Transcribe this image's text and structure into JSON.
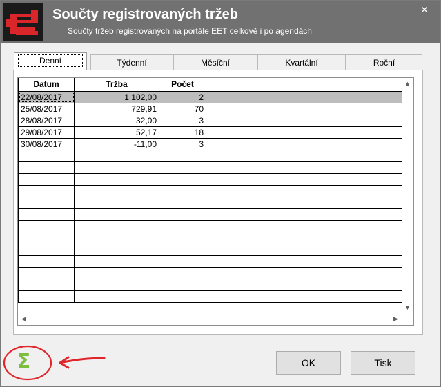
{
  "window": {
    "title": "Součty registrovaných tržeb",
    "subtitle": "Součty tržeb registrovaných na portále EET celkově i po agendách",
    "close_glyph": "✕",
    "accent_color": "#717171"
  },
  "tabs": [
    {
      "label": "Denní",
      "active": true
    },
    {
      "label": "Týdenní",
      "active": false
    },
    {
      "label": "Měsíční",
      "active": false
    },
    {
      "label": "Kvartální",
      "active": false
    },
    {
      "label": "Roční",
      "active": false
    }
  ],
  "table": {
    "columns": [
      "Datum",
      "Tržba",
      "Počet"
    ],
    "rows": [
      {
        "datum": "22/08/2017",
        "trzba": "1 102,00",
        "pocet": "2",
        "selected": true
      },
      {
        "datum": "25/08/2017",
        "trzba": "729,91",
        "pocet": "70",
        "selected": false
      },
      {
        "datum": "28/08/2017",
        "trzba": "32,00",
        "pocet": "3",
        "selected": false
      },
      {
        "datum": "29/08/2017",
        "trzba": "52,17",
        "pocet": "18",
        "selected": false
      },
      {
        "datum": "30/08/2017",
        "trzba": "-11,00",
        "pocet": "3",
        "selected": false
      }
    ]
  },
  "icons": {
    "app": "eet-logo-icon",
    "sum": "sigma-icon",
    "sum_glyph": "Σ",
    "sum_color": "#7cbf3f",
    "annotation_color": "#e0262b"
  },
  "buttons": {
    "ok_label": "OK",
    "print_label": "Tisk"
  }
}
